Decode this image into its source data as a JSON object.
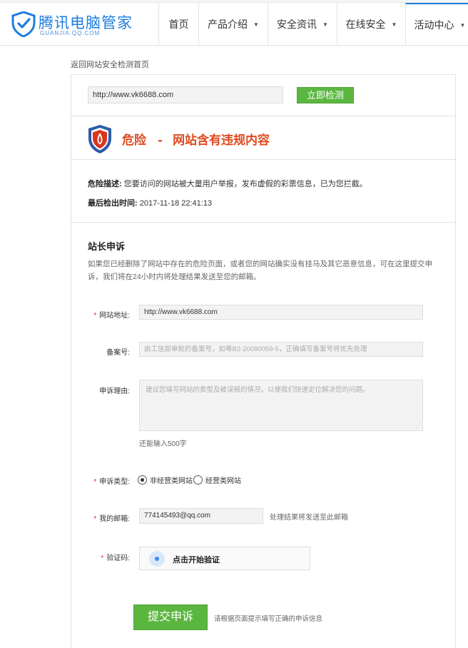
{
  "header": {
    "logo_title": "腾讯电脑管家",
    "logo_sub": "GUANJIA.QQ.COM",
    "nav": [
      {
        "label": "首页",
        "caret": false
      },
      {
        "label": "产品介绍",
        "caret": true
      },
      {
        "label": "安全资讯",
        "caret": true
      },
      {
        "label": "在线安全",
        "caret": true
      },
      {
        "label": "活动中心",
        "caret": true
      }
    ]
  },
  "back_link": "返回网站安全检测首页",
  "check": {
    "url_value": "http://www.vk6688.com",
    "button_label": "立即检测"
  },
  "result": {
    "level": "危险",
    "dash": "-",
    "summary": "网站含有违规内容",
    "desc_label": "危险描述:",
    "desc_text": "您要访问的网站被大量用户举报，发布虚假的彩票信息，已为您拦截。",
    "time_label": "最后检出时间:",
    "time_value": "2017-11-18 22:41:13"
  },
  "appeal": {
    "title": "站长申诉",
    "description": "如果您已经删除了网站中存在的危险页面，或者您的网站确实没有挂马及其它恶意信息，可在这里提交申诉，我们将在24小时内将处理结果发送至您的邮箱。",
    "site_label": "网站地址:",
    "site_value": "http://www.vk6688.com",
    "icp_label": "备案号:",
    "icp_placeholder": "由工信部审批的备案号，如粤B2-20090059-5，正确填写备案号将优先处理",
    "reason_label": "申诉理由:",
    "reason_placeholder": "建议您填写网站的类型及被误报的情况，以便我们快速定位解决您的问题。",
    "remaining": "还能输入500字",
    "type_label": "申诉类型:",
    "type_options": [
      "非经营类网站",
      "经营类网站"
    ],
    "type_selected": "非经营类网站",
    "email_label": "我的邮箱:",
    "email_value": "774145493@qq.com",
    "email_hint": "处理结果将发送至此邮箱",
    "captcha_label": "验证码:",
    "captcha_text": "点击开始验证",
    "submit_label": "提交申诉",
    "submit_hint": "请根据页面提示填写正确的申诉信息"
  },
  "colors": {
    "brand": "#1e7ce0",
    "green": "#5ab63f",
    "danger": "#e0491f"
  }
}
